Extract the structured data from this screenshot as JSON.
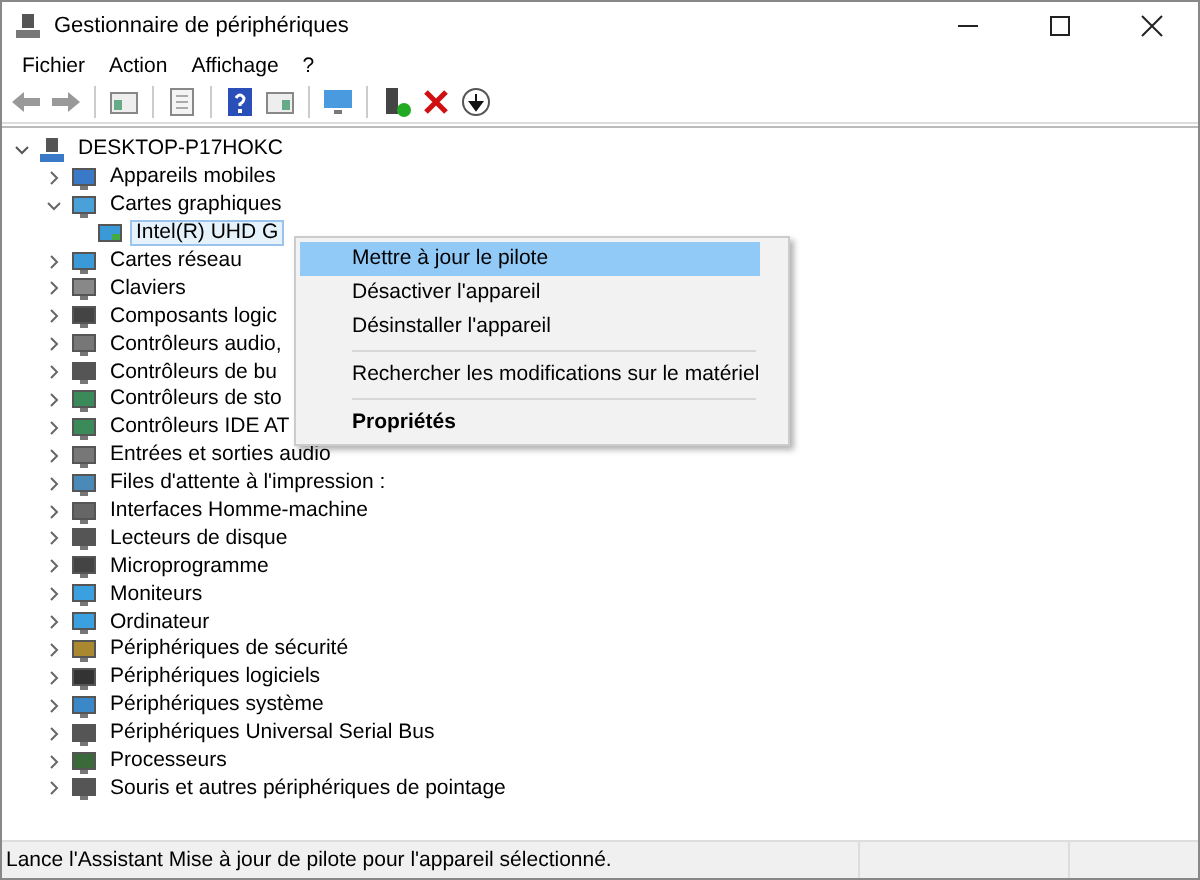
{
  "window": {
    "title": "Gestionnaire de périphériques"
  },
  "menu_bar": [
    "Fichier",
    "Action",
    "Affichage",
    "?"
  ],
  "tree": {
    "label": "DESKTOP-P17HOKC",
    "expanded": true,
    "selected": false,
    "children": [
      {
        "label": "Appareils mobiles",
        "expanded": false,
        "selected": false
      },
      {
        "label": "Cartes graphiques",
        "expanded": true,
        "selected": false,
        "children": [
          {
            "label": "Intel(R) UHD G",
            "selected": true
          }
        ]
      },
      {
        "label": "Cartes réseau",
        "expanded": false,
        "selected": false
      },
      {
        "label": "Claviers",
        "expanded": false,
        "selected": false
      },
      {
        "label": "Composants logic",
        "expanded": false,
        "selected": false
      },
      {
        "label": "Contrôleurs audio,",
        "expanded": false,
        "selected": false
      },
      {
        "label": "Contrôleurs de bu",
        "expanded": false,
        "selected": false
      },
      {
        "label": "Contrôleurs de sto",
        "expanded": false,
        "selected": false
      },
      {
        "label": "Contrôleurs IDE AT",
        "expanded": false,
        "selected": false
      },
      {
        "label": "Entrées et sorties audio",
        "expanded": false,
        "selected": false
      },
      {
        "label": "Files d'attente à l'impression :",
        "expanded": false,
        "selected": false
      },
      {
        "label": "Interfaces Homme-machine",
        "expanded": false,
        "selected": false
      },
      {
        "label": "Lecteurs de disque",
        "expanded": false,
        "selected": false
      },
      {
        "label": "Microprogramme",
        "expanded": false,
        "selected": false
      },
      {
        "label": "Moniteurs",
        "expanded": false,
        "selected": false
      },
      {
        "label": "Ordinateur",
        "expanded": false,
        "selected": false
      },
      {
        "label": "Périphériques de sécurité",
        "expanded": false,
        "selected": false
      },
      {
        "label": "Périphériques logiciels",
        "expanded": false,
        "selected": false
      },
      {
        "label": "Périphériques système",
        "expanded": false,
        "selected": false
      },
      {
        "label": "Périphériques Universal Serial Bus",
        "expanded": false,
        "selected": false
      },
      {
        "label": "Processeurs",
        "expanded": false,
        "selected": false
      },
      {
        "label": "Souris et autres périphériques de pointage",
        "expanded": false,
        "selected": false
      }
    ]
  },
  "context_menu": [
    {
      "kind": "item",
      "label": "Mettre à jour le pilote",
      "selected": true,
      "default": false
    },
    {
      "kind": "item",
      "label": "Désactiver l'appareil",
      "selected": false,
      "default": false
    },
    {
      "kind": "item",
      "label": "Désinstaller l'appareil",
      "selected": false,
      "default": false
    },
    {
      "kind": "separator"
    },
    {
      "kind": "item",
      "label": "Rechercher les modifications sur le matériel",
      "selected": false,
      "default": false
    },
    {
      "kind": "separator"
    },
    {
      "kind": "item",
      "label": "Propriétés",
      "selected": false,
      "default": true
    }
  ],
  "status_bar": "Lance l'Assistant Mise à jour de pilote pour l'appareil sélectionné."
}
